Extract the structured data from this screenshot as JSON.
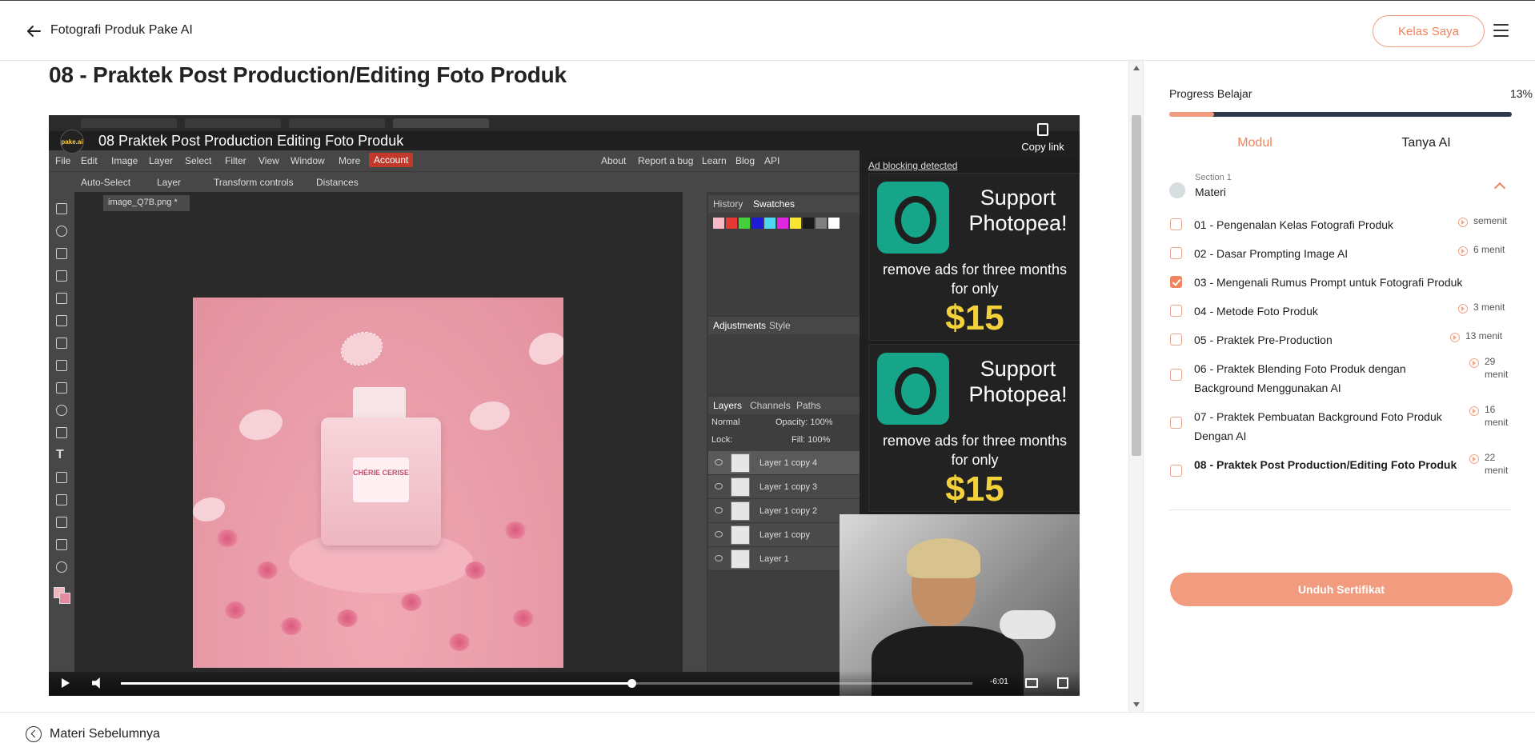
{
  "header": {
    "course_title": "Fotografi Produk Pake AI",
    "kelas_saya": "Kelas Saya"
  },
  "main": {
    "lesson_title": "08 - Praktek Post Production/Editing Foto Produk"
  },
  "video": {
    "title": "08 Praktek Post Production Editing Foto Produk",
    "channel_avatar": "pake.ai",
    "copy_link": "Copy link",
    "time_remaining": "-6:01",
    "progress_fraction": 0.6,
    "photopea": {
      "menu": [
        "File",
        "Edit",
        "Image",
        "Layer",
        "Select",
        "Filter",
        "View",
        "Window",
        "More"
      ],
      "account": "Account",
      "menu_right": [
        "About",
        "Report a bug",
        "Learn",
        "Blog",
        "API"
      ],
      "toolbar": {
        "auto_select": "Auto-Select",
        "layer": "Layer",
        "transform": "Transform controls",
        "distances": "Distances"
      },
      "doc_tab": "image_Q7B.png *",
      "panel_history": "History",
      "panel_swatches": "Swatches",
      "panel_adjustments": "Adjustments",
      "panel_style": "Style",
      "panel_layers": "Layers",
      "panel_channels": "Channels",
      "panel_paths": "Paths",
      "blend_mode": "Normal",
      "opacity": "Opacity: 100%",
      "lock": "Lock:",
      "fill": "Fill: 100%",
      "layers": [
        "Layer 1 copy 4",
        "Layer 1 copy 3",
        "Layer 1 copy 2",
        "Layer 1 copy",
        "Layer 1"
      ],
      "bottle_label": "CHÉRIE CERISE",
      "swatch_colors": [
        "#f5b8c4",
        "#e53935",
        "#43d13b",
        "#1b1bd8",
        "#4fd7ef",
        "#e026e0",
        "#f7e52f",
        "#1a1a1a",
        "#808080",
        "#ffffff"
      ]
    },
    "ad": {
      "label": "Ad blocking detected",
      "support": "Support Photopea!",
      "text": "remove ads for three months for only",
      "price": "$15"
    }
  },
  "sidebar": {
    "progress_label": "Progress Belajar",
    "progress_value": "13%",
    "progress_fraction": 0.13,
    "tabs": [
      "Modul",
      "Tanya AI"
    ],
    "section": {
      "sub": "Section 1",
      "name": "Materi"
    },
    "lessons": [
      {
        "title": "01 - Pengenalan Kelas Fotografi Produk",
        "duration": "semenit",
        "checked": false,
        "bold": false
      },
      {
        "title": "02 - Dasar Prompting Image AI",
        "duration": "6 menit",
        "checked": false,
        "bold": false
      },
      {
        "title": "03 - Mengenali Rumus Prompt untuk Fotografi Produk",
        "duration": "",
        "checked": true,
        "bold": false
      },
      {
        "title": "04 - Metode Foto Produk",
        "duration": "3 menit",
        "checked": false,
        "bold": false
      },
      {
        "title": "05 - Praktek Pre-Production",
        "duration": "13 menit",
        "checked": false,
        "bold": false
      },
      {
        "title": "06 - Praktek Blending Foto Produk dengan Background Menggunakan AI",
        "duration": "29 menit",
        "checked": false,
        "bold": false
      },
      {
        "title": "07 - Praktek Pembuatan Background Foto Produk Dengan AI",
        "duration": "16 menit",
        "checked": false,
        "bold": false
      },
      {
        "title": "08 - Praktek Post Production/Editing Foto Produk",
        "duration": "22 menit",
        "checked": false,
        "bold": true
      }
    ],
    "certificate_button": "Unduh Sertifikat"
  },
  "footer": {
    "prev_label": "Materi Sebelumnya"
  },
  "colors": {
    "accent": "#f0845e",
    "accent_light": "#f29c7f",
    "progress_track": "#2e3a4b"
  }
}
